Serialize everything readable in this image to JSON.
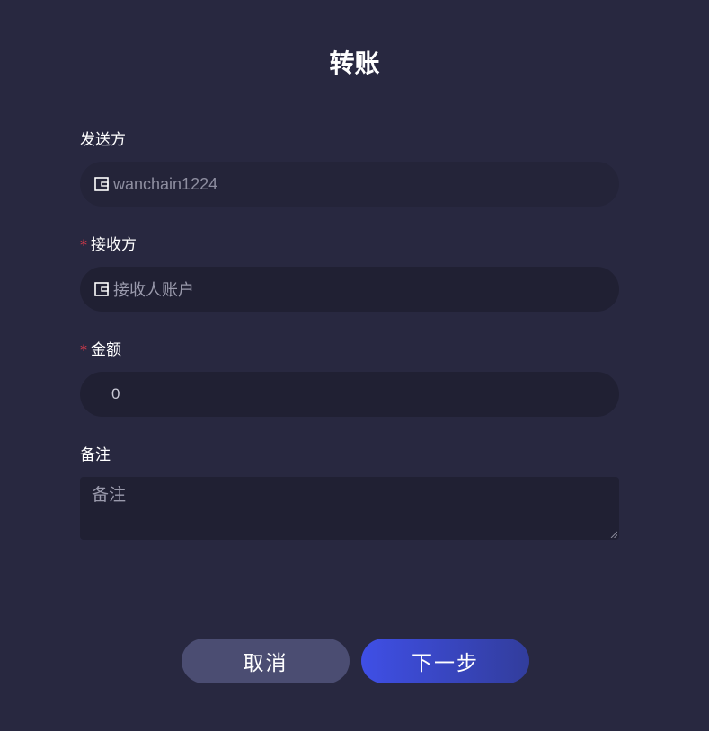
{
  "dialog": {
    "title": "转账"
  },
  "sender": {
    "label": "发送方",
    "value": "wanchain1224",
    "icon": "wallet-icon"
  },
  "recipient": {
    "label": "接收方",
    "required_mark": "*",
    "placeholder": "接收人账户",
    "icon": "wallet-icon"
  },
  "amount": {
    "label": "金额",
    "required_mark": "*",
    "value": "0"
  },
  "memo": {
    "label": "备注",
    "placeholder": "备注"
  },
  "actions": {
    "cancel_label": "取消",
    "next_label": "下一步"
  },
  "colors": {
    "background": "#282840",
    "input_background": "#202033",
    "required": "#d63a4a",
    "cancel_button": "#4b4d72",
    "next_button_start": "#3f4fe6",
    "next_button_end": "#323d9c"
  }
}
